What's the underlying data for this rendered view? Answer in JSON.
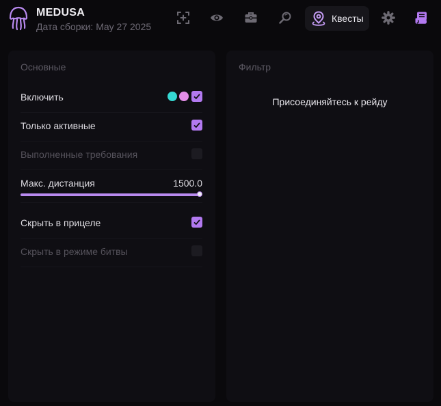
{
  "app": {
    "title": "MEDUSA",
    "build_info": "Дата сборки: May 27 2025",
    "accent_color": "#b279f0"
  },
  "nav": {
    "items": [
      {
        "icon": "crosshair-icon"
      },
      {
        "icon": "eye-icon"
      },
      {
        "icon": "briefcase-icon"
      },
      {
        "icon": "search-icon"
      },
      {
        "icon": "map-pin-icon",
        "label": "Квесты",
        "active": true
      },
      {
        "icon": "gear-icon"
      },
      {
        "icon": "receipt-icon"
      }
    ]
  },
  "main_panel": {
    "title": "Основные",
    "enable": {
      "label": "Включить",
      "checked": true,
      "color_swatches": [
        "#35d7d2",
        "#e48ee8"
      ]
    },
    "only_active": {
      "label": "Только активные",
      "checked": true
    },
    "completed_requirements": {
      "label": "Выполненные требования",
      "checked": false,
      "disabled": true
    },
    "max_distance": {
      "label": "Макс. дистанция",
      "value_text": "1500.0",
      "value": 1500.0,
      "fill_fraction": 1.0
    },
    "hide_in_scope": {
      "label": "Скрыть в прицеле",
      "checked": true
    },
    "hide_in_battle": {
      "label": "Скрыть в режиме битвы",
      "checked": false,
      "disabled": true
    }
  },
  "filter_panel": {
    "title": "Фильтр",
    "message": "Присоединяйтесь к рейду"
  }
}
